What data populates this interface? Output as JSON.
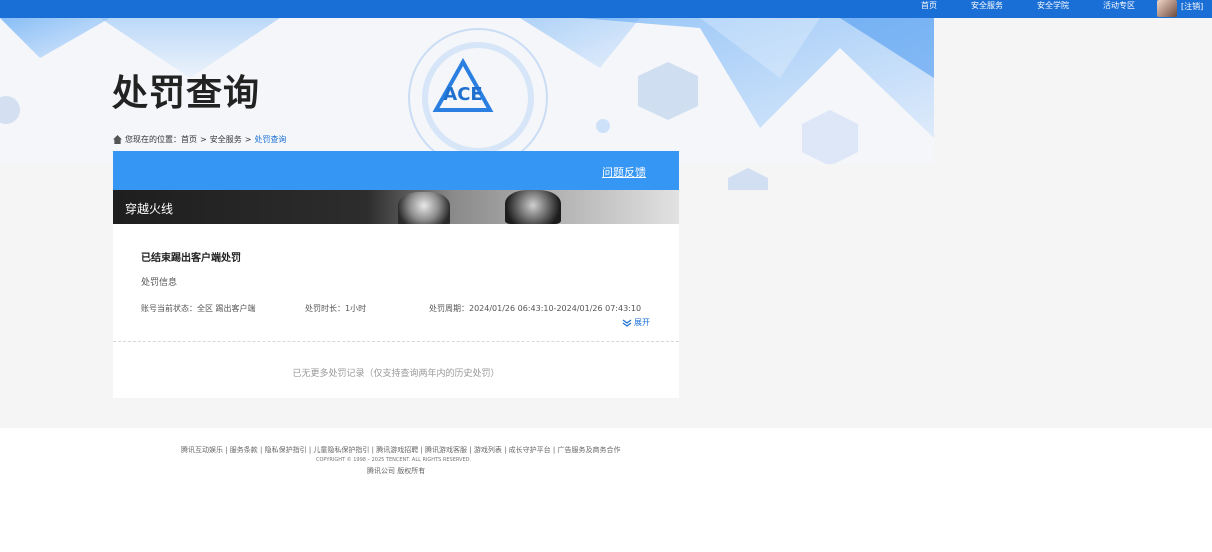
{
  "topnav": {
    "items": [
      "首页",
      "安全服务",
      "安全学院",
      "活动专区"
    ],
    "logout": "[注销]"
  },
  "banner": {
    "title": "处罚查询",
    "logo_text": "ACE"
  },
  "breadcrumb": {
    "prefix": "您现在的位置：",
    "home": "首页",
    "sep": ">",
    "section": "安全服务",
    "current": "处罚查询"
  },
  "panel": {
    "feedback": "问题反馈",
    "game_name": "穿越火线",
    "record": {
      "title": "已结束踢出客户端处罚",
      "subtitle": "处罚信息",
      "status": "账号当前状态：全区 踢出客户端",
      "duration": "处罚时长：1小时",
      "period": "处罚周期：2024/01/26 06:43:10-2024/01/26 07:43:10",
      "expand": "展开"
    },
    "no_more": "已无更多处罚记录（仅支持查询两年内的历史处罚）"
  },
  "footer": {
    "links": "腾讯互动娱乐 | 服务条款 | 隐私保护指引 | 儿童隐私保护指引 | 腾讯游戏招聘 | 腾讯游戏客服 | 游戏列表 | 成长守护平台 | 广告服务及商务合作",
    "copyright": "COPYRIGHT © 1998 – 2025 TENCENT. ALL RIGHTS RESERVED.",
    "company": "腾讯公司 版权所有"
  },
  "colors": {
    "topbar": "#1a6fd6",
    "panel_head": "#3596f3",
    "link": "#1a6fd6"
  }
}
